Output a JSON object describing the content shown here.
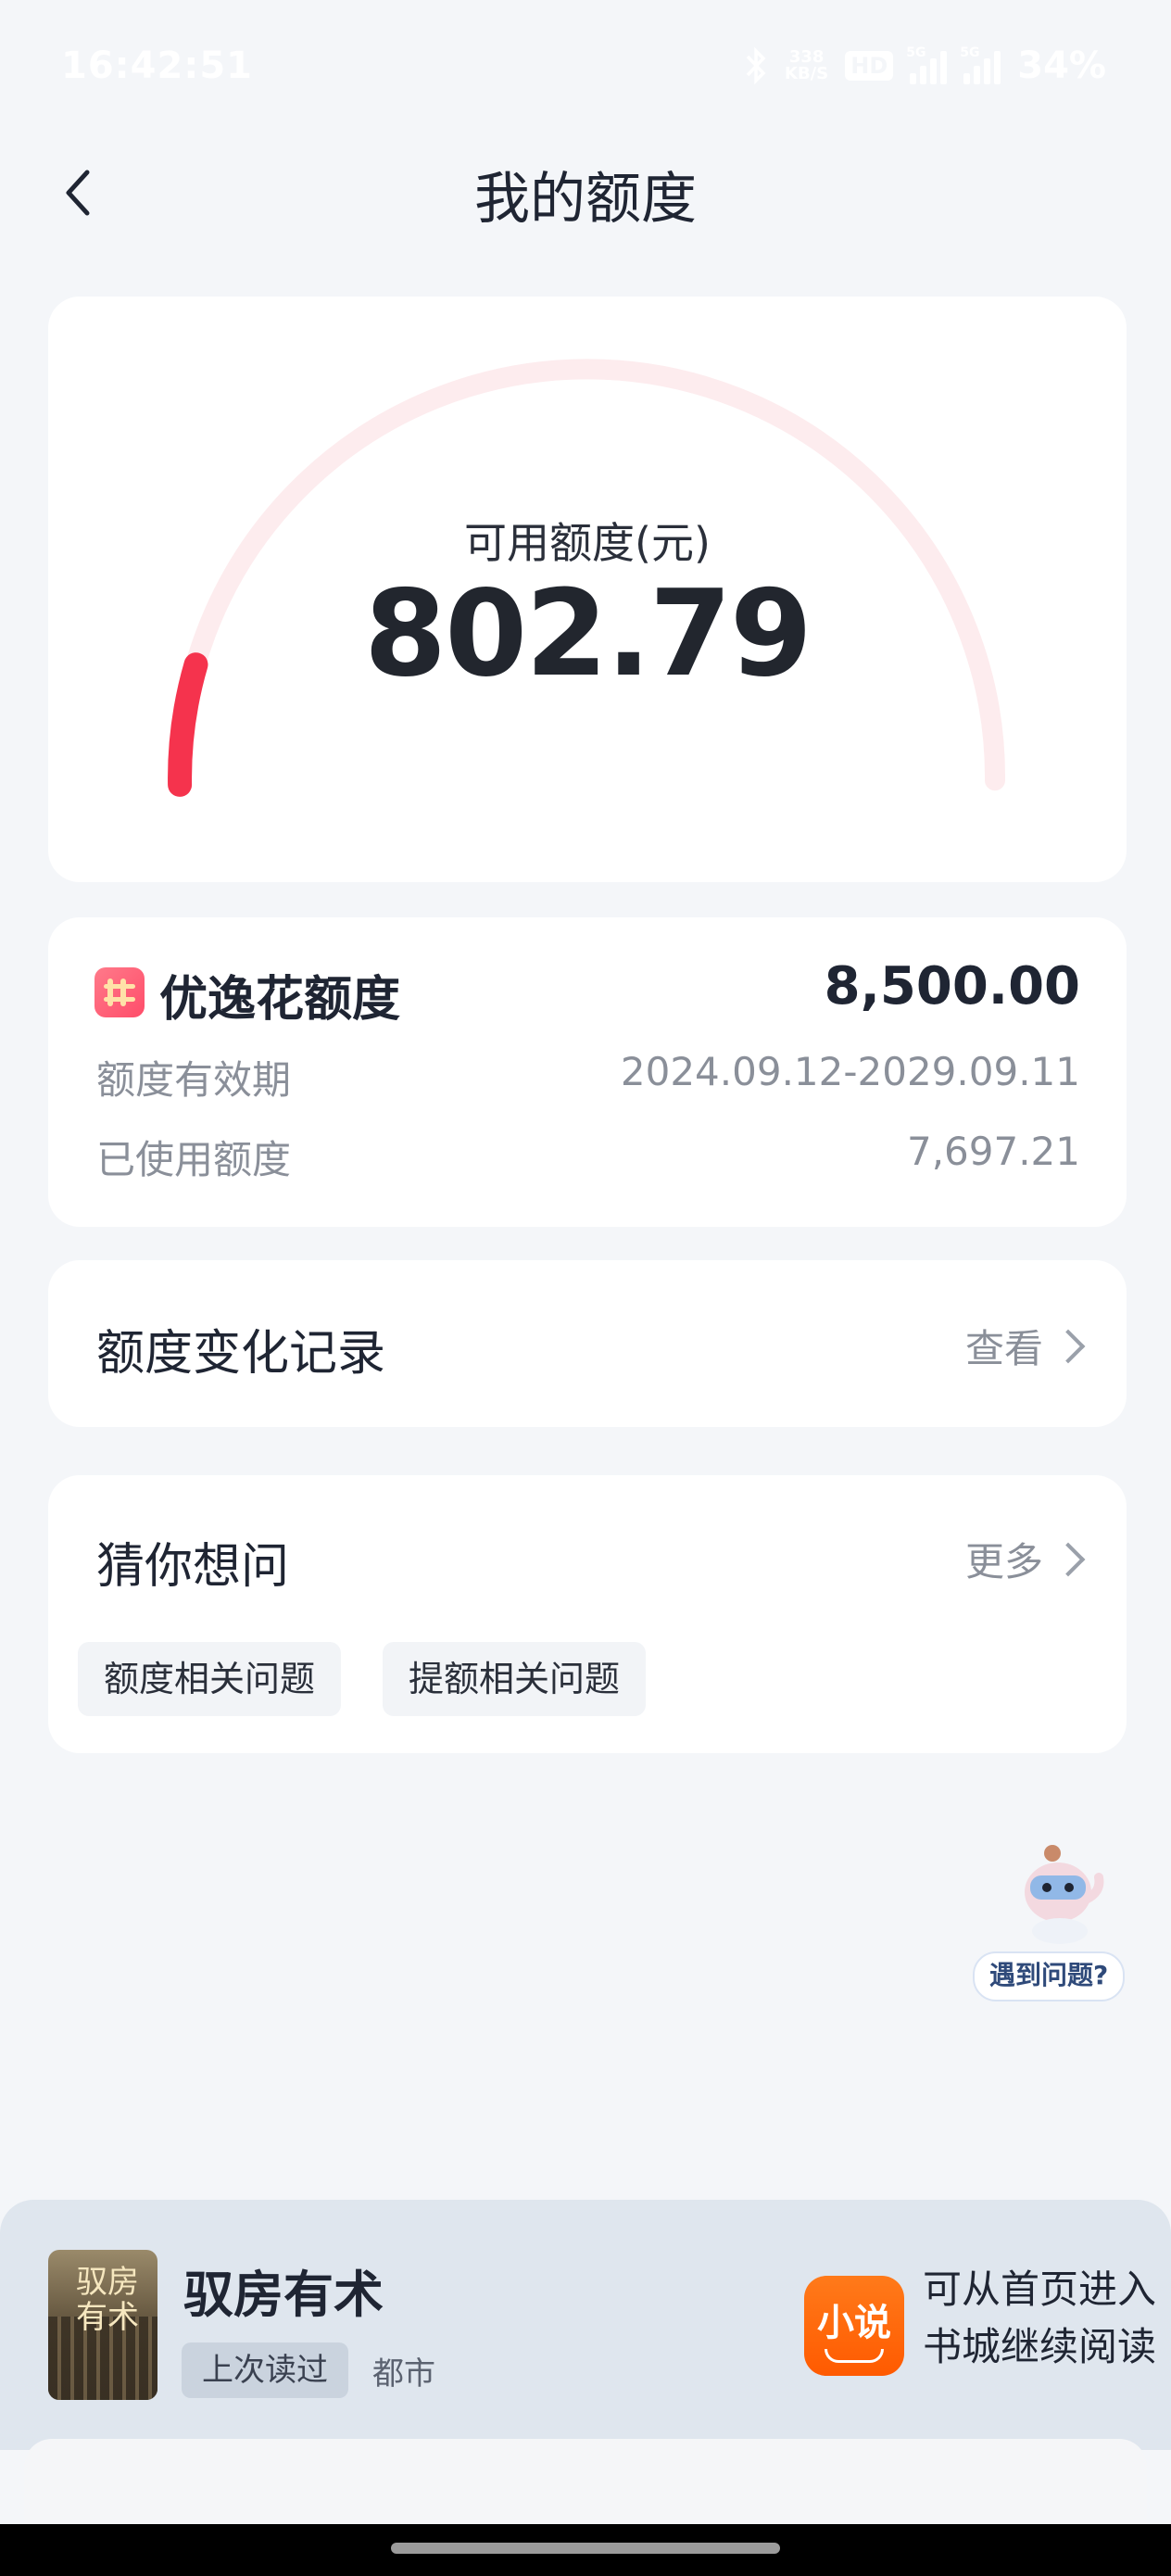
{
  "status_bar": {
    "time": "16:42:51",
    "net_speed_value": "338",
    "net_speed_unit": "KB/S",
    "hd_label": "HD",
    "signal1_label": "5G",
    "signal2_label": "5G",
    "battery": "34%"
  },
  "header": {
    "title": "我的额度"
  },
  "gauge": {
    "label": "可用额度(元)",
    "value": "802.79",
    "used_fraction": 0.0944,
    "track_color": "#fdecee",
    "fill_color": "#f5334d"
  },
  "quota": {
    "name": "优逸花额度",
    "total": "8,500.00",
    "validity_label": "额度有效期",
    "validity_value": "2024.09.12-2029.09.11",
    "used_label": "已使用额度",
    "used_value": "7,697.21"
  },
  "history": {
    "title": "额度变化记录",
    "link": "查看"
  },
  "faq": {
    "title": "猜你想问",
    "more": "更多",
    "chips": [
      "额度相关问题",
      "提额相关问题"
    ]
  },
  "helper": {
    "label": "遇到问题?"
  },
  "reader": {
    "cover_text": "驭房有术",
    "book_title": "驭房有术",
    "tag": "上次读过",
    "genre": "都市",
    "app_name": "小说",
    "tip_line1": "可从首页进入",
    "tip_line2": "书城继续阅读"
  }
}
